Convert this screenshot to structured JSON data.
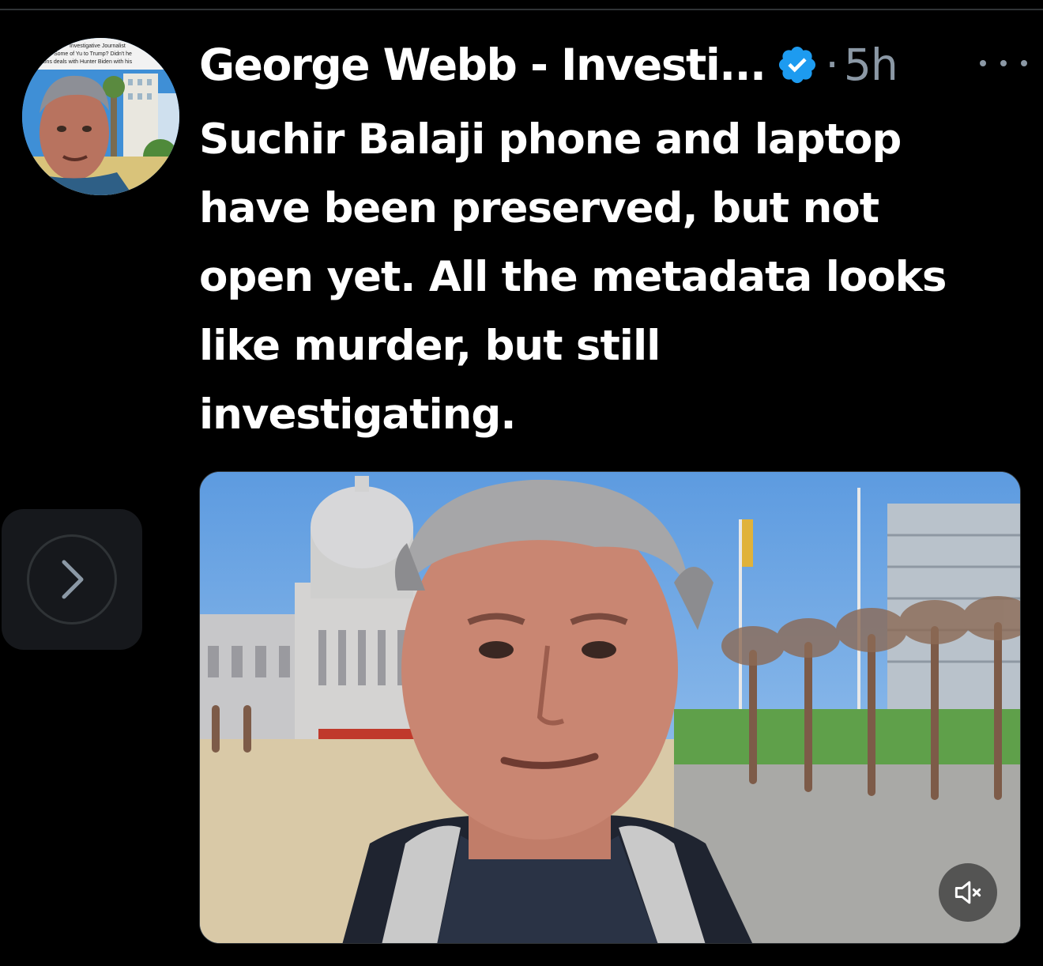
{
  "post": {
    "author_name": "George Webb - Investi...",
    "verified": true,
    "separator": "·",
    "time": "5h",
    "text_lines": [
      "Suchir Balaji phone and laptop",
      "have been preserved, but not",
      "open yet. All the metadata looks",
      "like murder, but still",
      "investigating."
    ]
  },
  "avatar": {
    "banner_lines": [
      "Investigative Journalist",
      "Some of Yu to Trump? Didn't he",
      "Pons deals with Hunter Biden with his"
    ]
  },
  "icons": {
    "verified": "verified-badge-icon",
    "more": "more-horizontal-icon",
    "next": "chevron-right-icon",
    "mute": "speaker-muted-icon"
  },
  "colors": {
    "background": "#000000",
    "text": "#ffffff",
    "secondary_text": "#8b98a5",
    "verified_blue": "#1d9bf0",
    "divider": "#2f3336"
  }
}
